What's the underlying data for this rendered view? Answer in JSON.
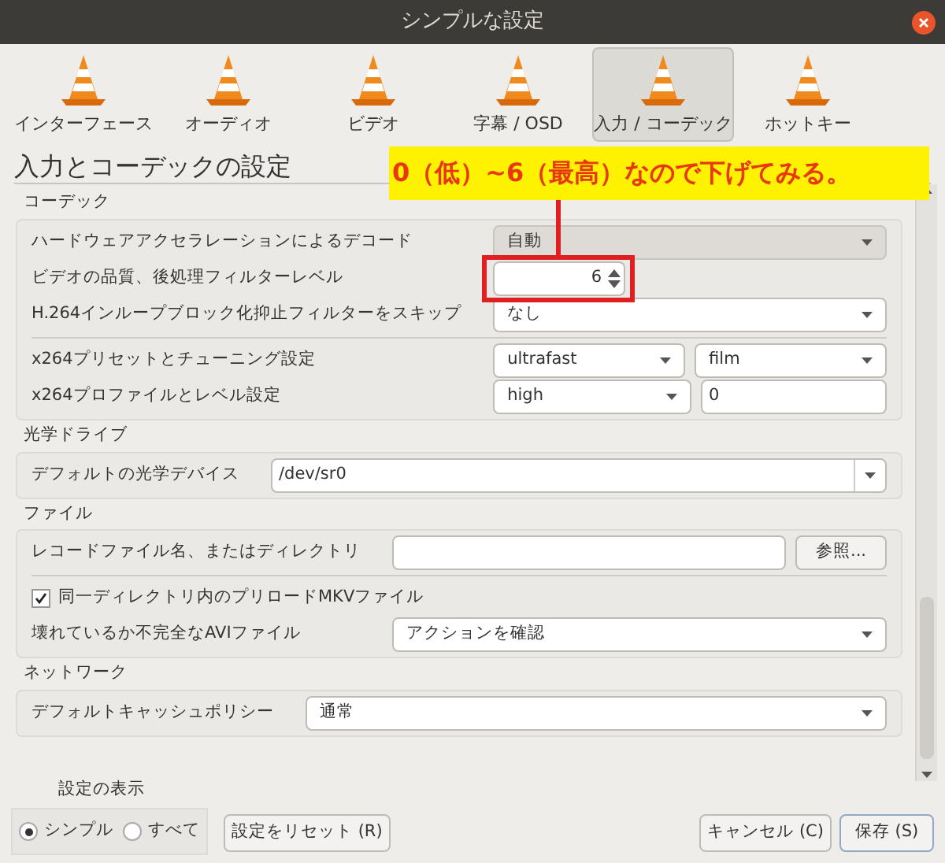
{
  "window": {
    "title": "シンプルな設定"
  },
  "tabs": [
    {
      "label": "インターフェース",
      "selected": false
    },
    {
      "label": "オーディオ",
      "selected": false
    },
    {
      "label": "ビデオ",
      "selected": false
    },
    {
      "label": "字幕 / OSD",
      "selected": false
    },
    {
      "label": "入力 / コーデック",
      "selected": true
    },
    {
      "label": "ホットキー",
      "selected": false
    }
  ],
  "heading": "入力とコーデックの設定",
  "annotation": {
    "text": "0（低）~6（最高）なので下げてみる。"
  },
  "sections": [
    {
      "title": "コーデック",
      "rows": [
        {
          "kind": "row",
          "label": "ハードウェアアクセラレーションによるデコード",
          "controls": [
            {
              "kind": "dropdown",
              "value": "自動"
            }
          ]
        },
        {
          "kind": "row",
          "label": "ビデオの品質、後処理フィルターレベル",
          "controls": [
            {
              "kind": "spin",
              "value": "6"
            }
          ]
        },
        {
          "kind": "row",
          "label": "H.264インループブロック化抑止フィルターをスキップ",
          "controls": [
            {
              "kind": "combo",
              "value": "なし"
            }
          ]
        },
        {
          "kind": "separator"
        },
        {
          "kind": "row",
          "label": "x264プリセットとチューニング設定",
          "controls": [
            {
              "kind": "combo",
              "value": "ultrafast"
            },
            {
              "kind": "combo",
              "value": "film"
            }
          ]
        },
        {
          "kind": "row",
          "label": "x264プロファイルとレベル設定",
          "controls": [
            {
              "kind": "combo",
              "value": "high"
            },
            {
              "kind": "field",
              "value": "0"
            }
          ]
        }
      ]
    },
    {
      "title": "光学ドライブ",
      "rows": [
        {
          "kind": "row",
          "label": "デフォルトの光学デバイス",
          "controls": [
            {
              "kind": "editcombo",
              "value": "/dev/sr0"
            }
          ]
        }
      ]
    },
    {
      "title": "ファイル",
      "rows": [
        {
          "kind": "row",
          "label": "レコードファイル名、またはディレクトリ",
          "controls": [
            {
              "kind": "field"
            },
            {
              "kind": "button",
              "value": "参照..."
            }
          ]
        },
        {
          "kind": "separator"
        },
        {
          "kind": "check",
          "label": "同一ディレクトリ内のプリロードMKVファイル",
          "checked": true
        },
        {
          "kind": "row",
          "label": "壊れているか不完全なAVIファイル",
          "controls": [
            {
              "kind": "combo",
              "value": "アクションを確認"
            }
          ]
        }
      ]
    },
    {
      "title": "ネットワーク",
      "rows": [
        {
          "kind": "row",
          "label": "デフォルトキャッシュポリシー",
          "controls": [
            {
              "kind": "combo",
              "value": "通常"
            }
          ]
        }
      ]
    }
  ],
  "footer": {
    "view_label": "設定の表示",
    "radios": [
      {
        "label": "シンプル",
        "selected": true
      },
      {
        "label": "すべて",
        "selected": false
      }
    ],
    "reset_button": "設定をリセット (R)",
    "buttons": [
      {
        "label": "キャンセル (C)",
        "default": false
      },
      {
        "label": "保存 (S)",
        "default": true
      }
    ]
  }
}
